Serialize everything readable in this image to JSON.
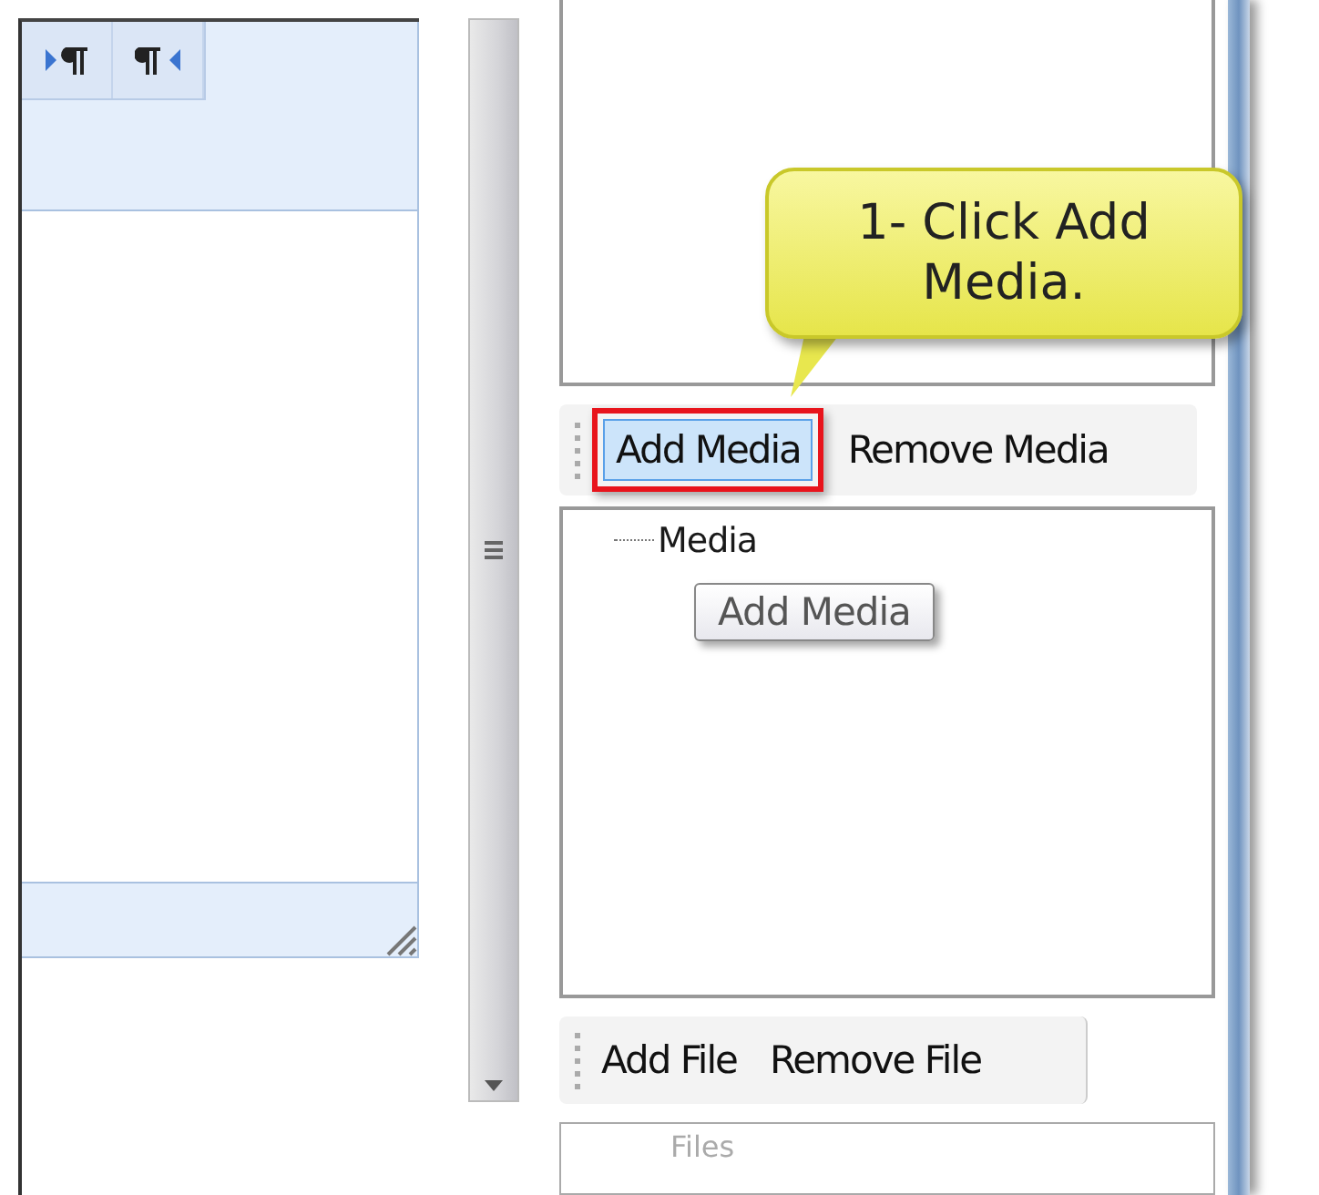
{
  "media_toolbar": {
    "buttons": [
      {
        "label": "Add Media",
        "selected": true
      },
      {
        "label": "Remove Media",
        "selected": false
      }
    ]
  },
  "media_tree": {
    "items": [
      {
        "label": "Media"
      }
    ]
  },
  "tooltip": {
    "text": "Add Media"
  },
  "callout": {
    "text": "1- Click Add Media."
  },
  "file_toolbar": {
    "buttons": [
      {
        "label": "Add File"
      },
      {
        "label": "Remove File"
      }
    ]
  },
  "files_field": {
    "placeholder": "Files"
  }
}
